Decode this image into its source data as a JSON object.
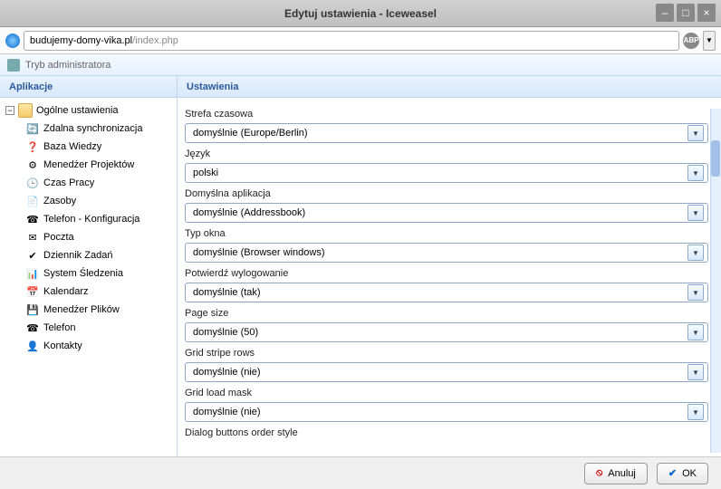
{
  "window": {
    "title": "Edytuj ustawienia - Iceweasel"
  },
  "address": {
    "host": "budujemy-domy-vika.pl",
    "path": "/index.php"
  },
  "toolbar": {
    "admin_mode": "Tryb administratora"
  },
  "sidebar": {
    "header": "Aplikacje",
    "root": "Ogólne ustawienia",
    "items": [
      {
        "label": "Zdalna synchronizacja",
        "icon": "🔄"
      },
      {
        "label": "Baza Wiedzy",
        "icon": "❓"
      },
      {
        "label": "Menedżer Projektów",
        "icon": "⚙"
      },
      {
        "label": "Czas Pracy",
        "icon": "🕒"
      },
      {
        "label": "Zasoby",
        "icon": "📄"
      },
      {
        "label": "Telefon - Konfiguracja",
        "icon": "☎"
      },
      {
        "label": "Poczta",
        "icon": "✉"
      },
      {
        "label": "Dziennik Zadań",
        "icon": "✔"
      },
      {
        "label": "System Śledzenia",
        "icon": "📊"
      },
      {
        "label": "Kalendarz",
        "icon": "📅"
      },
      {
        "label": "Menedżer Plików",
        "icon": "💾"
      },
      {
        "label": "Telefon",
        "icon": "☎"
      },
      {
        "label": "Kontakty",
        "icon": "👤"
      }
    ]
  },
  "form": {
    "header": "Ustawienia",
    "fields": [
      {
        "label": "Strefa czasowa",
        "value": "domyślnie (Europe/Berlin)"
      },
      {
        "label": "Język",
        "value": "polski"
      },
      {
        "label": "Domyślna aplikacja",
        "value": "domyślnie (Addressbook)"
      },
      {
        "label": "Typ okna",
        "value": "domyślnie (Browser windows)"
      },
      {
        "label": "Potwierdź wylogowanie",
        "value": "domyślnie (tak)"
      },
      {
        "label": "Page size",
        "value": "domyślnie (50)"
      },
      {
        "label": "Grid stripe rows",
        "value": "domyślnie (nie)"
      },
      {
        "label": "Grid load mask",
        "value": "domyślnie (nie)"
      },
      {
        "label": "Dialog buttons order style",
        "value": ""
      }
    ]
  },
  "footer": {
    "cancel": "Anuluj",
    "ok": "OK"
  }
}
